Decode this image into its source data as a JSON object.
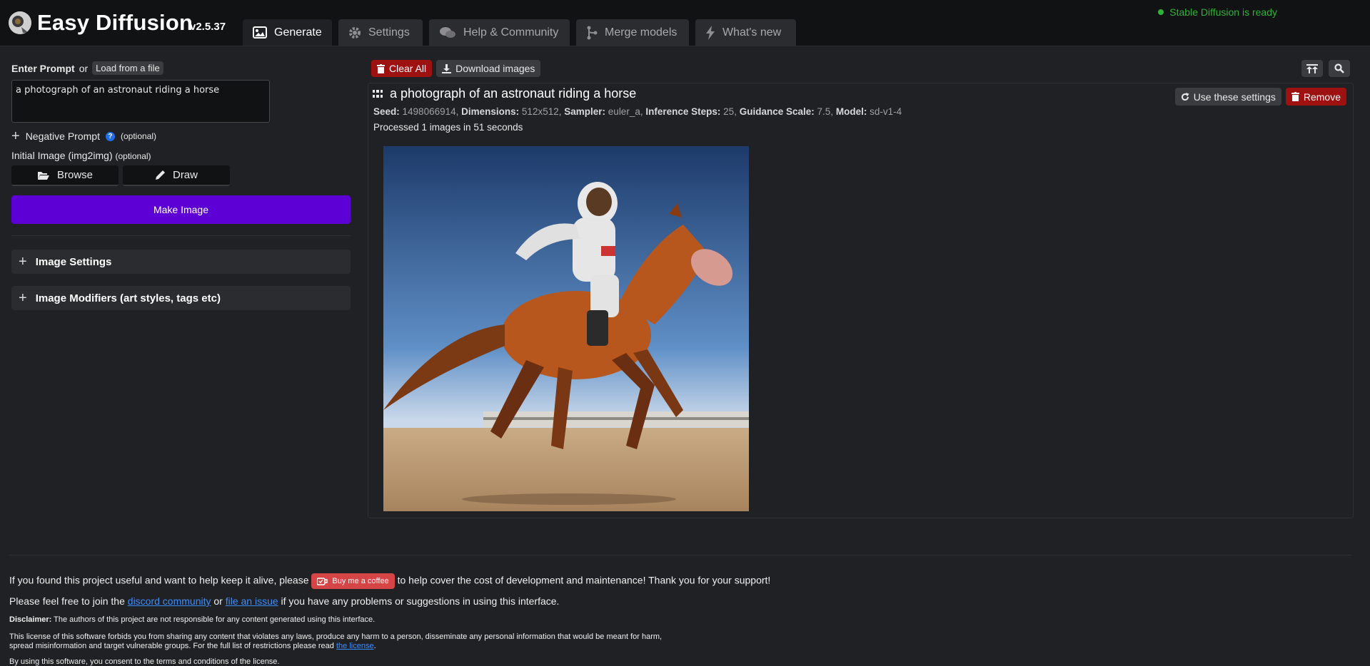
{
  "app": {
    "brand": "Easy Diffusion",
    "version": "v2.5.37",
    "status": "Stable Diffusion is ready"
  },
  "tabs": [
    {
      "label": "Generate",
      "icon": "image-icon",
      "active": true
    },
    {
      "label": "Settings",
      "icon": "gear-icon",
      "active": false
    },
    {
      "label": "Help & Community",
      "icon": "comments-icon",
      "active": false
    },
    {
      "label": "Merge models",
      "icon": "code-merge-icon",
      "active": false
    },
    {
      "label": "What's new",
      "icon": "bolt-icon",
      "active": false
    }
  ],
  "prompt": {
    "label": "Enter Prompt",
    "or": "or",
    "load_file": "Load from a file",
    "value": "a photograph of an astronaut riding a horse",
    "negative_label": "Negative Prompt",
    "negative_optional": "(optional)",
    "init_label": "Initial Image (img2img)",
    "init_optional": "(optional)",
    "browse": "Browse",
    "draw": "Draw",
    "make": "Make Image"
  },
  "accordions": {
    "image_settings": "Image Settings",
    "modifiers": "Image Modifiers (art styles, tags etc)"
  },
  "toolbar": {
    "clear_all": "Clear All",
    "download": "Download images"
  },
  "task": {
    "title": "a photograph of an astronaut riding a horse",
    "seed_k": "Seed:",
    "seed_v": "1498066914",
    "dim_k": "Dimensions:",
    "dim_v": "512x512",
    "sampler_k": "Sampler:",
    "sampler_v": "euler_a",
    "steps_k": "Inference Steps:",
    "steps_v": "25",
    "guidance_k": "Guidance Scale:",
    "guidance_v": "7.5",
    "model_k": "Model:",
    "model_v": "sd-v1-4",
    "processed": "Processed 1 images in 51 seconds",
    "use_settings": "Use these settings",
    "remove": "Remove"
  },
  "footer": {
    "line1_a": "If you found this project useful and want to help keep it alive, please",
    "coffee": "Buy me a coffee",
    "line1_b": "to help cover the cost of development and maintenance! Thank you for your support!",
    "line2_a": "Please feel free to join the",
    "discord": "discord community",
    "line2_or": "or",
    "issue": "file an issue",
    "line2_b": "if you have any problems or suggestions in using this interface.",
    "disclaimer_k": "Disclaimer:",
    "disclaimer_v": "The authors of this project are not responsible for any content generated using this interface.",
    "license_1": "This license of this software forbids you from sharing any content that violates any laws, produce any harm to a person, disseminate any personal information that would be meant for harm,",
    "license_2": "spread misinformation and target vulnerable groups. For the full list of restrictions please read",
    "license_link": "the license",
    "license_end": ".",
    "consent": "By using this software, you consent to the terms and conditions of the license."
  },
  "colors": {
    "accent_purple": "#5c00d6",
    "danger_red": "#9e1111",
    "ready_green": "#2fb13a",
    "link_blue": "#3a8dff"
  }
}
